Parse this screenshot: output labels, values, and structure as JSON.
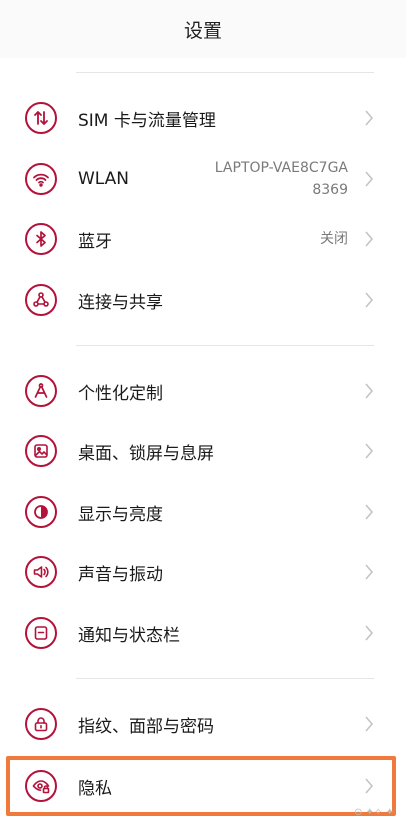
{
  "header": {
    "title": "设置"
  },
  "rows": [
    {
      "label": "SIM 卡与流量管理",
      "icon": "sim-data-icon"
    },
    {
      "label": "WLAN",
      "icon": "wifi-icon",
      "value_line1": "LAPTOP-VAE8C7GA",
      "value_line2": "8369"
    },
    {
      "label": "蓝牙",
      "icon": "bluetooth-icon",
      "value": "关闭"
    },
    {
      "label": "连接与共享",
      "icon": "share-icon"
    },
    {
      "label": "个性化定制",
      "icon": "compass-icon"
    },
    {
      "label": "桌面、锁屏与息屏",
      "icon": "wallpaper-icon"
    },
    {
      "label": "显示与亮度",
      "icon": "brightness-icon"
    },
    {
      "label": "声音与振动",
      "icon": "volume-icon"
    },
    {
      "label": "通知与状态栏",
      "icon": "notification-icon"
    },
    {
      "label": "指纹、面部与密码",
      "icon": "lock-icon"
    },
    {
      "label": "隐私",
      "icon": "privacy-eye-icon"
    }
  ],
  "accent_color": "#b3123a",
  "highlight_color": "#f07a3c",
  "watermark": "⊙ ✦✧ ✦"
}
